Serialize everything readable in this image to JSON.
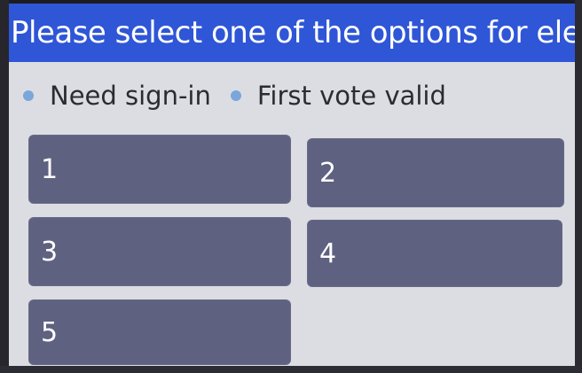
{
  "header": {
    "title": "Please select one of the options for election"
  },
  "rules": [
    {
      "label": "Need sign-in"
    },
    {
      "label": "First vote valid"
    }
  ],
  "options": [
    {
      "label": "1"
    },
    {
      "label": "2"
    },
    {
      "label": "3"
    },
    {
      "label": "4"
    },
    {
      "label": "5"
    }
  ],
  "colors": {
    "header_bg": "#2f56d6",
    "option_bg": "#5f6180",
    "bullet": "#7aa7d8",
    "screen_bg": "#dcdde3"
  }
}
